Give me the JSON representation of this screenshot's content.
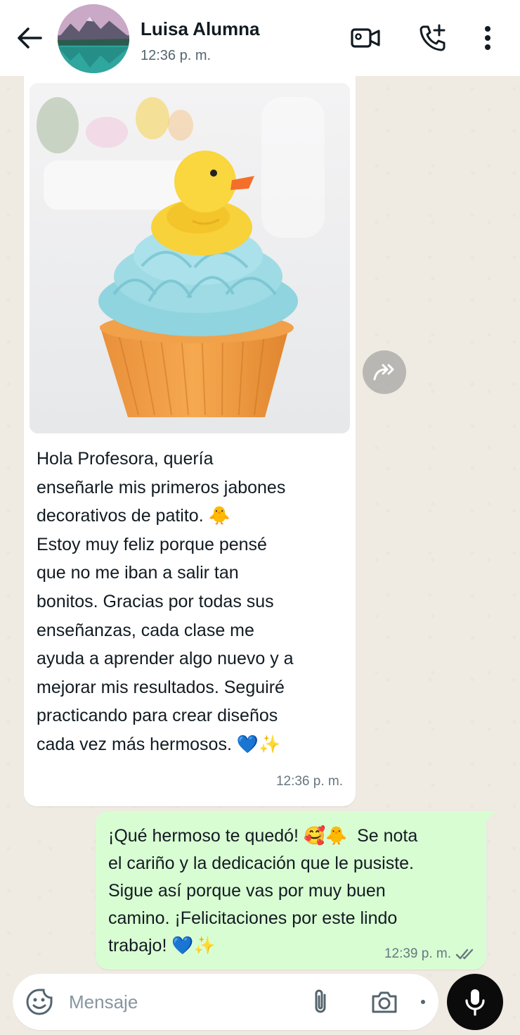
{
  "header": {
    "contact_name": "Luisa Alumna",
    "status": "12:36 p. m.",
    "icons": [
      "back-arrow-icon",
      "video-call-icon",
      "add-call-icon",
      "more-options-icon"
    ]
  },
  "messages": [
    {
      "direction": "incoming",
      "has_image": true,
      "image_subject": "duck-cupcake-soap-photo",
      "text": "Hola Profesora, quería\nenseñarle mis primeros jabones\ndecorativos de patito. 🐥\nEstoy muy feliz porque pensé\nque no me iban a salir tan\nbonitos. Gracias por todas sus\nenseñanzas, cada clase me\nayuda a aprender algo nuevo y a\nmejorar mis resultados. Seguiré\npracticando para crear diseños\ncada vez más hermosos. 💙✨",
      "time": "12:36 p. m."
    },
    {
      "direction": "outgoing",
      "text": "¡Qué hermoso te quedó! 🥰🐥  Se nota\nel cariño y la dedicación que le pusiste.\nSigue así porque vas por muy buen\ncamino. ¡Felicitaciones por este lindo\ntrabajo! 💙✨",
      "time": "12:39 p. m.",
      "read_status": "double-tick-icon"
    }
  ],
  "composer": {
    "placeholder": "Mensaje",
    "value": ""
  },
  "colors": {
    "chat_background": "#efeae2",
    "incoming_bubble": "#ffffff",
    "outgoing_bubble": "#d9fdd3",
    "mic_button": "#0b0b0b"
  }
}
